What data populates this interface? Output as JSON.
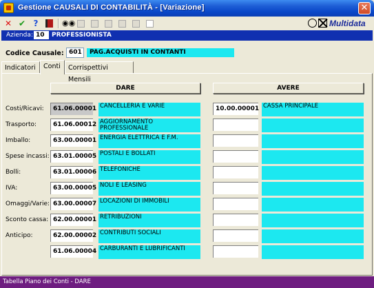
{
  "window": {
    "title": "Gestione CAUSALI DI CONTABILITÀ - [Variazione]",
    "close_glyph": "✕"
  },
  "toolbar": {
    "items": [
      "close-x-icon",
      "confirm-check-icon",
      "help-icon",
      "book-icon",
      "binoculars-icon",
      "copy-icon",
      "stack-icon",
      "delete-icon",
      "paste-icon",
      "new-document-icon"
    ]
  },
  "logo": {
    "text": "Multidata"
  },
  "azienda": {
    "label": "Azienda:",
    "code": "10",
    "name": "PROFESSIONISTA"
  },
  "causale": {
    "label": "Codice Causale:",
    "code": "601",
    "description": "PAG.ACQUISTI IN CONTANTI"
  },
  "tabs": [
    "Indicatori",
    "Conti",
    "Corrispettivi Mensili"
  ],
  "columns": {
    "dare": "DARE",
    "avere": "AVERE"
  },
  "rows": [
    {
      "label": "Costi/Ricavi:",
      "dare_code": "61.06.00001",
      "dare_desc": "CANCELLERIA E VARIE",
      "avere_code": "10.00.00001",
      "avere_desc": "CASSA PRINCIPALE"
    },
    {
      "label": "Trasporto:",
      "dare_code": "61.06.00012",
      "dare_desc": "AGGIORNAMENTO\nPROFESSIONALE",
      "avere_code": "",
      "avere_desc": ""
    },
    {
      "label": "Imballo:",
      "dare_code": "63.00.00001",
      "dare_desc": "ENERGIA ELETTRICA E F.M.",
      "avere_code": "",
      "avere_desc": ""
    },
    {
      "label": "Spese incassi:",
      "dare_code": "63.01.00005",
      "dare_desc": "POSTALI E BOLLATI",
      "avere_code": "",
      "avere_desc": ""
    },
    {
      "label": "Bolli:",
      "dare_code": "63.01.00006",
      "dare_desc": "TELEFONICHE",
      "avere_code": "",
      "avere_desc": ""
    },
    {
      "label": "IVA:",
      "dare_code": "63.00.00005",
      "dare_desc": "NOLI E LEASING",
      "avere_code": "",
      "avere_desc": ""
    },
    {
      "label": "Omaggi/Varie:",
      "dare_code": "63.00.00007",
      "dare_desc": "LOCAZIONI DI IMMOBILI",
      "avere_code": "",
      "avere_desc": ""
    },
    {
      "label": "Sconto cassa:",
      "dare_code": "62.00.00001",
      "dare_desc": "RETRIBUZIONI",
      "avere_code": "",
      "avere_desc": ""
    },
    {
      "label": "Anticipo:",
      "dare_code": "62.00.00002",
      "dare_desc": "CONTRIBUTI SOCIALI",
      "avere_code": "",
      "avere_desc": ""
    },
    {
      "label": "",
      "dare_code": "61.06.00004",
      "dare_desc": "CARBURANTI E LUBRIFICANTI",
      "avere_code": "",
      "avere_desc": ""
    }
  ],
  "status": {
    "text": "Tabella Piano dei Conti - DARE"
  },
  "colors": {
    "title_bar": "#0a48c9",
    "azienda_bar": "#1030b0",
    "description_bg": "#1ce8f0",
    "status_bar": "#6e1d80"
  }
}
